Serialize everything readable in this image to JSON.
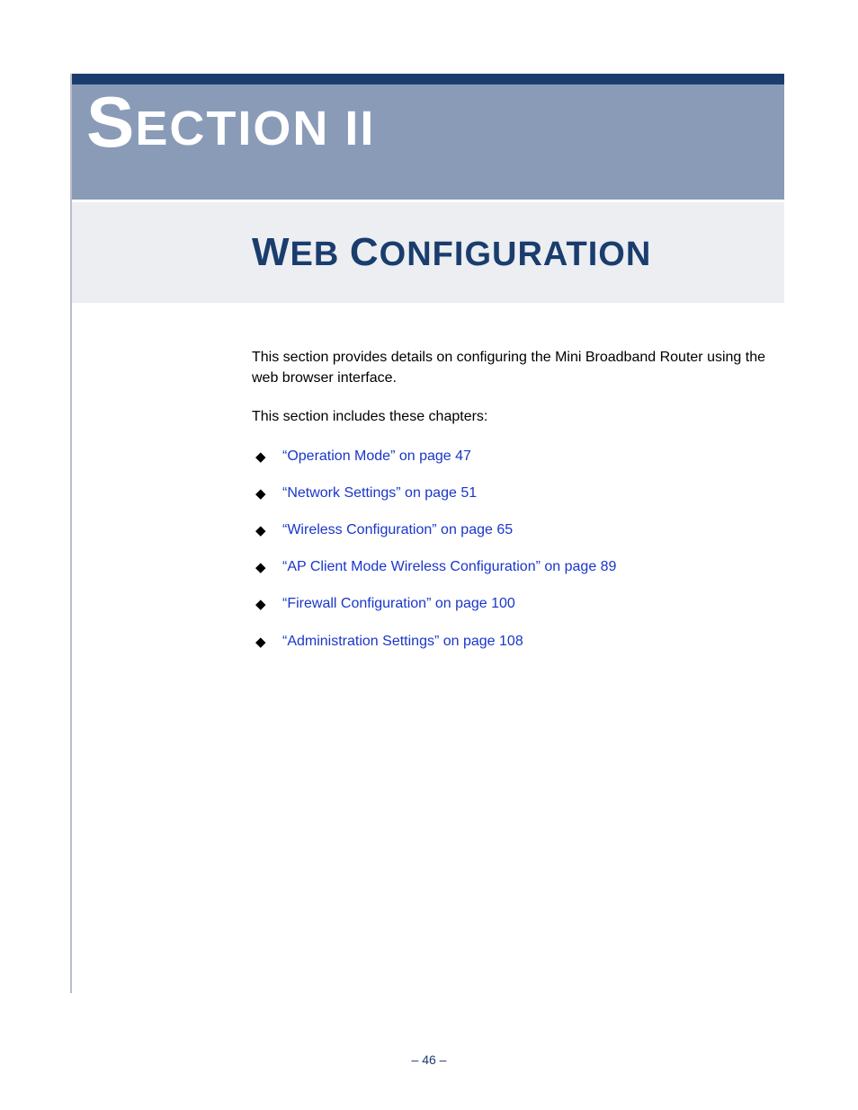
{
  "section": {
    "label_first_letter": "S",
    "label_rest": "ECTION II"
  },
  "title": {
    "w_cap": "W",
    "w_rest": "EB",
    "space": " ",
    "c_cap": "C",
    "c_rest": "ONFIGURATION"
  },
  "intro": {
    "para1": "This section provides details on configuring the Mini Broadband Router using the web browser interface.",
    "para2": "This section includes these chapters:"
  },
  "chapters": [
    "“Operation Mode” on page 47",
    "“Network Settings” on page 51",
    "“Wireless Configuration” on page 65",
    "“AP Client Mode Wireless Configuration” on page 89",
    "“Firewall Configuration” on page 100",
    "“Administration Settings” on page 108"
  ],
  "footer": {
    "page_number": "–  46  –"
  }
}
